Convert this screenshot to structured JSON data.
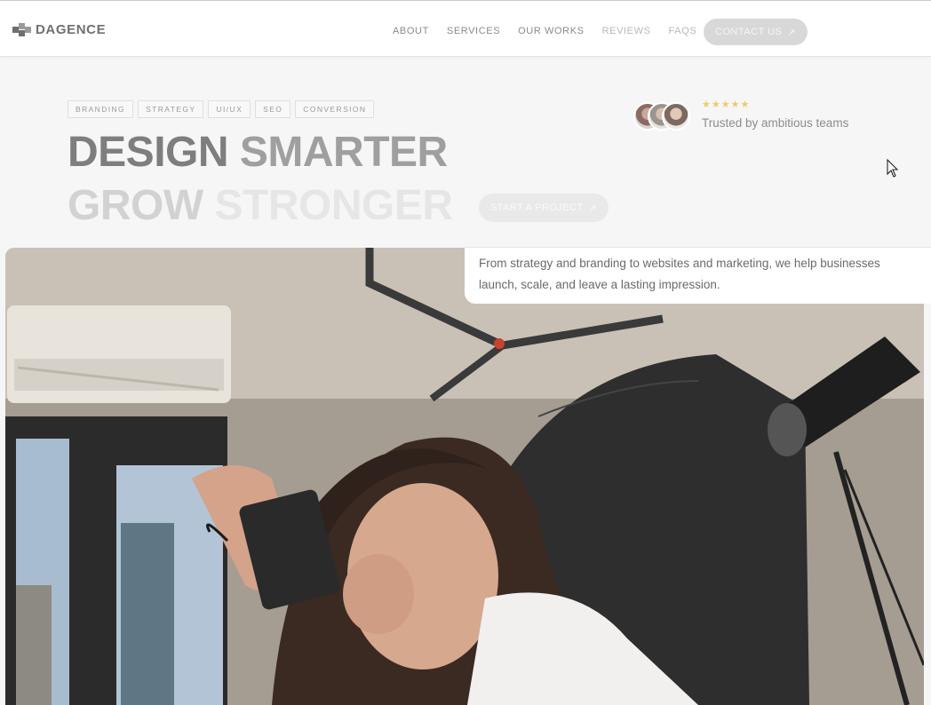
{
  "brand": {
    "name": "DAGENCE"
  },
  "nav": {
    "items": [
      "ABOUT",
      "SERVICES",
      "OUR WORKS",
      "REVIEWS",
      "FAQS"
    ],
    "contact_label": "CONTACT US"
  },
  "hero": {
    "tags": [
      "BRANDING",
      "STRATEGY",
      "UI/UX",
      "SEO",
      "CONVERSION"
    ],
    "headline": {
      "line1_a": "DESIGN",
      "line1_b": "SMARTER",
      "line2_a": "GROW",
      "line2_b": "STRONGER"
    },
    "cta_label": "START A PROJECT",
    "rating": "★★★★★",
    "trust_text": "Trusted by ambitious teams",
    "description_line1": "From strategy and branding to websites and marketing, we help businesses",
    "description_line2": "launch, scale, and leave a lasting impression."
  },
  "colors": {
    "background": "#f6f6f6",
    "star": "#f1c86a"
  },
  "icons": [
    "logo-mark-icon",
    "arrow-up-right-icon",
    "mouse-cursor-icon"
  ]
}
